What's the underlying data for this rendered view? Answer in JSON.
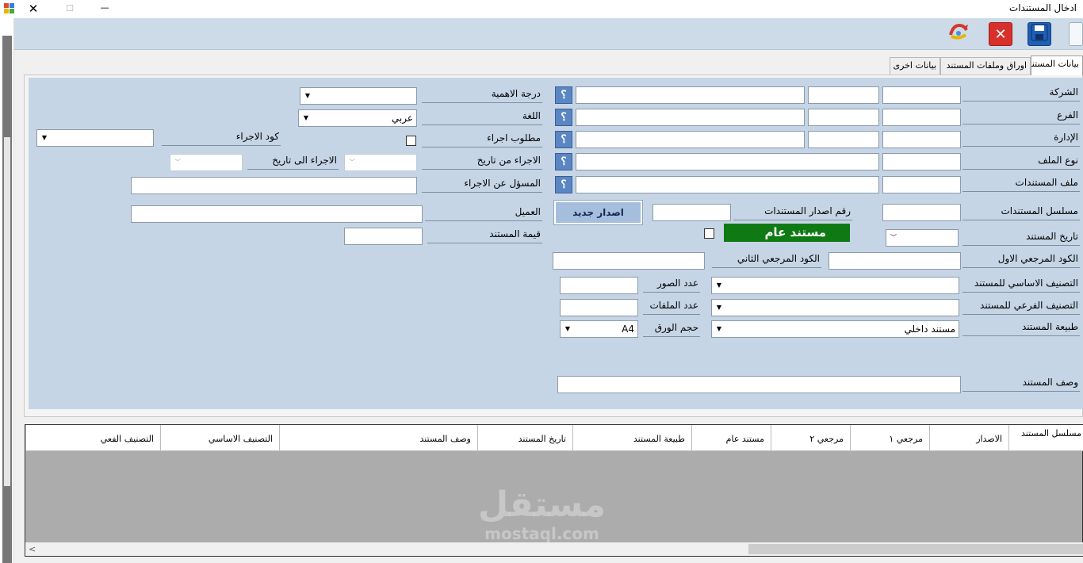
{
  "window": {
    "title": "ادخال المستندات",
    "minimize_glyph": "—",
    "maximize_glyph": "☐",
    "close_glyph": "✕"
  },
  "toolbar": {
    "icons": [
      "refresh-icon",
      "close-form-icon",
      "save-icon"
    ],
    "close_glyph": "✕",
    "save_glyph": "💾"
  },
  "tabs": [
    {
      "label": "بيانات المستند"
    },
    {
      "label": "اوراق وملفات المستند"
    },
    {
      "label": "بيانات اخرى"
    }
  ],
  "form": {
    "company_label": "الشركة",
    "branch_label": "الفرع",
    "department_label": "الإدارة",
    "file_type_label": "نوع الملف",
    "documents_file_label": "ملف المستندات",
    "doc_serial_label": "مسلسل المستندات",
    "issue_number_label": "رقم اصدار المستندات",
    "new_issue_button": "اصدار جديد",
    "doc_date_label": "تاريخ المستند",
    "general_doc_label": "مستند عام",
    "first_ref_label": "الكود المرجعي الاول",
    "second_ref_label": "الكود المرجعي الثاني",
    "main_class_label": "التصنيف الاساسي للمستند",
    "sub_class_label": "التصنيف الفرعي للمستند",
    "doc_nature_label": "طبيعة المستند",
    "doc_nature_value": "مستند داخلي",
    "images_count_label": "عدد الصور",
    "files_count_label": "عدد الملفات",
    "paper_size_label": "حجم الورق",
    "paper_size_value": "A4",
    "description_label": "وصف المستند",
    "importance_label": "درجة الاهمية",
    "language_label": "اللغة",
    "language_value": "عربي",
    "action_required_label": "مطلوب اجراء",
    "action_code_label": "كود الاجراء",
    "action_from_label": "الاجراء من تاريخ",
    "action_to_label": "الاجراء الى تاريخ",
    "action_responsible_label": "المسؤل عن الاجراء",
    "client_label": "العميل",
    "doc_value_label": "قيمة المستند",
    "lookup_glyph": "؟"
  },
  "grid": {
    "columns": [
      "مسلسل المستند",
      "الاصدار",
      "مرجعي ١",
      "مرجعي ٢",
      "مستند عام",
      "طبيعة المستند",
      "تاريخ المستند",
      "وصف المستند",
      "التصنيف الاساسي",
      "التصنيف الفعي"
    ],
    "scroll_left_glyph": "<"
  },
  "watermark": {
    "arabic": "مستقل",
    "latin": "mostaql.com"
  }
}
